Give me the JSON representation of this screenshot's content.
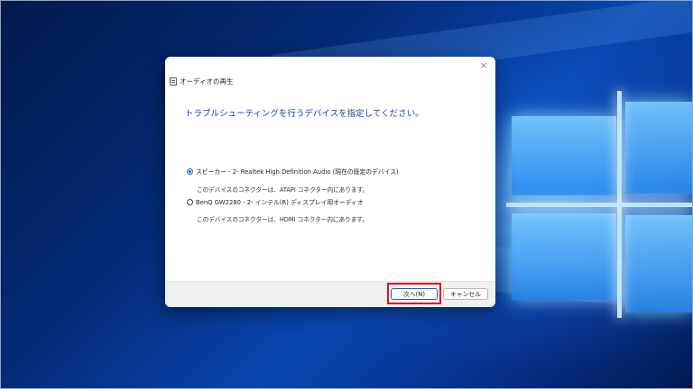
{
  "dialog": {
    "title": "オーディオの再生",
    "heading": "トラブルシューティングを行うデバイスを指定してください。",
    "options": [
      {
        "label": "スピーカー - 2- Realtek High Definition Audio (現在の既定のデバイス)",
        "description": "このデバイスのコネクターは、ATAPI コネクター内にあります。",
        "selected": true
      },
      {
        "label": "BenQ GW2280 - 2- インテル(R) ディスプレイ用オーディオ",
        "description": "このデバイスのコネクターは、HDMI コネクター内にあります。",
        "selected": false
      }
    ],
    "buttons": {
      "next": "次へ(N)",
      "cancel": "キャンセル"
    },
    "close_icon": "×"
  },
  "colors": {
    "heading": "#1e3f9a",
    "highlight": "#e3101b",
    "accent": "#1a5fd0"
  }
}
